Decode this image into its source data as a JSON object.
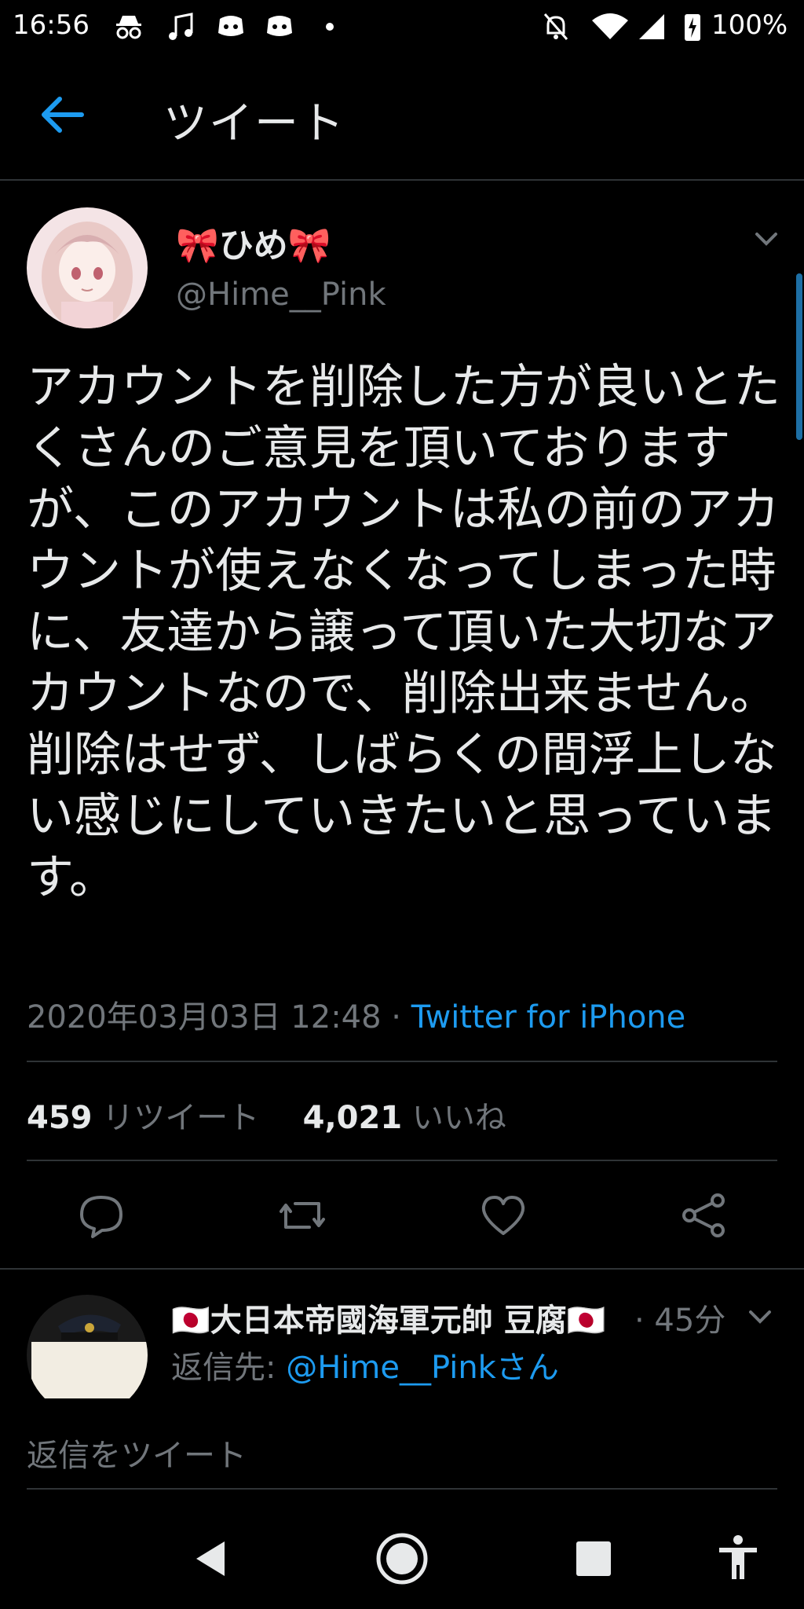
{
  "status_bar": {
    "time": "16:56",
    "battery": "100%",
    "icons": [
      "incognito-icon",
      "music-icon",
      "discord-icon",
      "discord-icon",
      "dot-icon",
      "bell-off-icon",
      "wifi-icon",
      "signal-icon",
      "battery-icon"
    ]
  },
  "header": {
    "title": "ツイート"
  },
  "tweet": {
    "display_name": "🎀ひめ🎀",
    "handle": "@Hime__Pink",
    "text": "アカウントを削除した方が良いとたくさんのご意見を頂いておりますが、このアカウントは私の前のアカウントが使えなくなってしまった時に、友達から譲って頂いた大切なアカウントなので、削除出来ません。\n削除はせず、しばらくの間浮上しない感じにしていきたいと思っています。",
    "timestamp": "2020年03月03日 12:48",
    "separator": " · ",
    "source": "Twitter for iPhone",
    "retweets_count": "459",
    "retweets_label": "リツイート",
    "likes_count": "4,021",
    "likes_label": "いいね"
  },
  "reply": {
    "display_name": "🇯🇵大日本帝國海軍元帥 豆腐🇯🇵",
    "time": "· 45分",
    "reply_to_label": "返信先: ",
    "reply_to_handle": "@Hime__Pinkさん"
  },
  "compose": {
    "placeholder": "返信をツイート"
  },
  "colors": {
    "accent": "#1d9bf0",
    "background": "#000000",
    "muted": "#71767b"
  }
}
